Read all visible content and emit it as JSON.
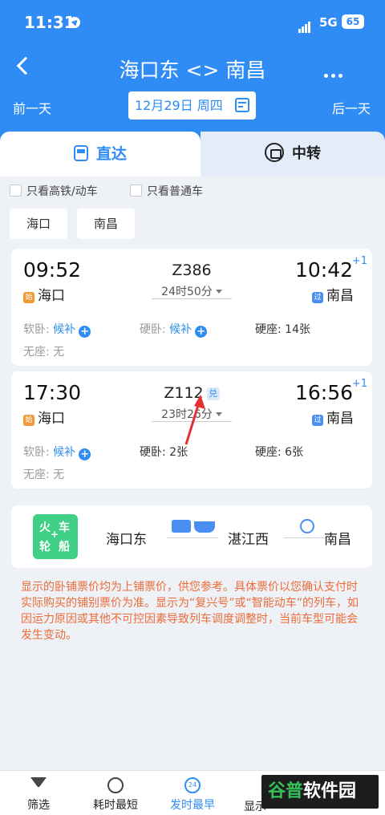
{
  "status_bar": {
    "time": "11:31",
    "network": "5G",
    "battery": "65"
  },
  "header": {
    "title": "海口东 <> 南昌",
    "prev_day": "前一天",
    "next_day": "后一天",
    "date": "12月29日 周四"
  },
  "tabs": [
    {
      "label": "直达",
      "active": true
    },
    {
      "label": "中转",
      "active": false
    }
  ],
  "filters": {
    "high_speed_only": "只看高铁/动车",
    "normal_only": "只看普通车"
  },
  "station_filters": [
    "海口",
    "南昌"
  ],
  "trains": [
    {
      "depart_time": "09:52",
      "train_no": "Z386",
      "duration": "24时50分",
      "arrive_time": "10:42",
      "day_offset": "+1",
      "depart_station": "海口",
      "depart_tag": "始",
      "arrive_station": "南昌",
      "arrive_tag": "过",
      "seats": {
        "soft_sleeper_label": "软卧: ",
        "soft_sleeper_value": "候补",
        "hard_sleeper_label": "硬卧: ",
        "hard_sleeper_value": "候补",
        "hard_seat_label": "硬座: ",
        "hard_seat_value": "14张",
        "no_seat_label": "无座: ",
        "no_seat_value": "无"
      }
    },
    {
      "depart_time": "17:30",
      "train_no": "Z112",
      "train_badge": "兑",
      "duration": "23时26分",
      "arrive_time": "16:56",
      "day_offset": "+1",
      "depart_station": "海口",
      "depart_tag": "始",
      "arrive_station": "南昌",
      "arrive_tag": "过",
      "seats": {
        "soft_sleeper_label": "软卧: ",
        "soft_sleeper_value": "候补",
        "hard_sleeper_label": "硬卧: ",
        "hard_sleeper_value": "2张",
        "hard_seat_label": "硬座: ",
        "hard_seat_value": "6张",
        "no_seat_label": "无座: ",
        "no_seat_value": "无"
      }
    }
  ],
  "transfer": {
    "badge": [
      "火",
      "车",
      "轮",
      "+",
      "船"
    ],
    "from": "海口东",
    "via": "湛江西",
    "to": "南昌"
  },
  "notice": "显示的卧铺票价均为上铺票价，供您参考。具体票价以您确认支付时实际购买的铺别票价为准。显示为“复兴号”或“智能动车”的列车，如因运力原因或其他不可控因素导致列车调度调整时，当前车型可能会发生变动。",
  "bottom_bar": [
    {
      "label": "筛选",
      "icon": "funnel-icon"
    },
    {
      "label": "耗时最短",
      "icon": "clock-icon"
    },
    {
      "label": "发时最早",
      "icon": "24h-icon",
      "badge": "24",
      "active": true
    },
    {
      "label": "显示",
      "icon": ""
    }
  ],
  "watermark": {
    "prefix": "谷普",
    "suffix": "软件园"
  },
  "colors": {
    "primary": "#2f8cf4",
    "warning": "#ec6c3a",
    "ferry": "#3fcf85"
  }
}
